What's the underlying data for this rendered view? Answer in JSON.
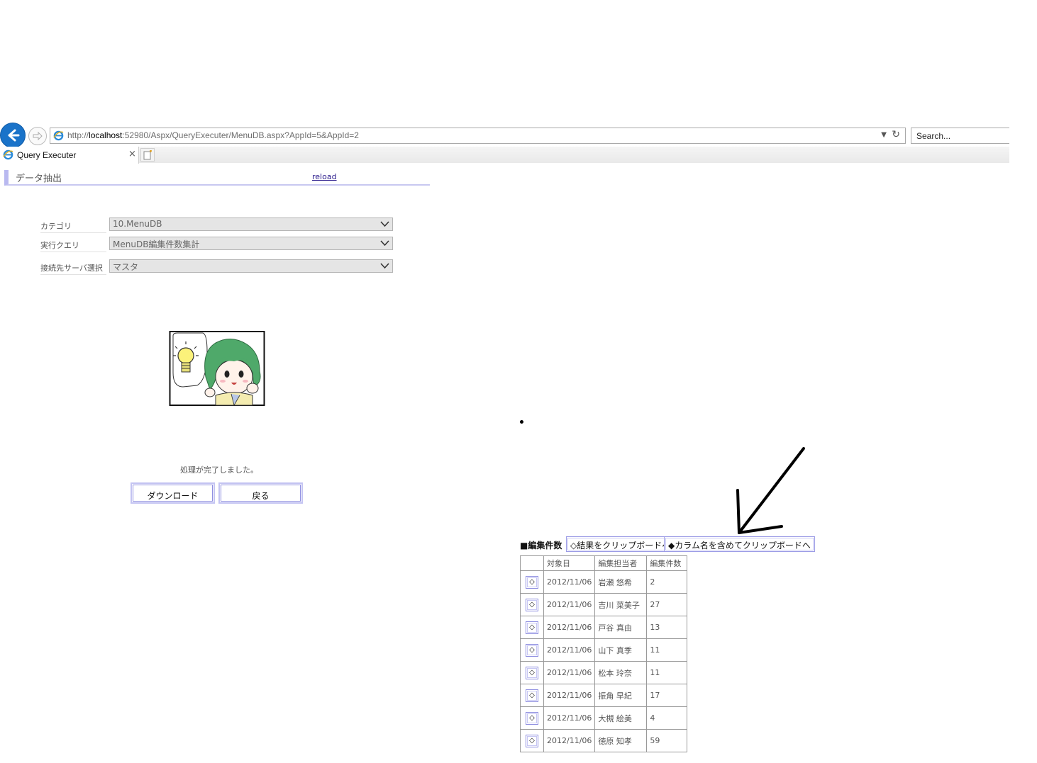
{
  "browser": {
    "url_prefix": "http://",
    "url_host": "localhost",
    "url_rest": ":52980/Aspx/QueryExecuter/MenuDB.aspx?AppId=5&AppId=2",
    "search_placeholder": "Search...",
    "tab_title": "Query Executer",
    "tab_close": "×"
  },
  "header": {
    "title": "データ抽出",
    "reload": "reload"
  },
  "form": {
    "category_label": "カテゴリ",
    "category_value": "10.MenuDB",
    "query_label": "実行クエリ",
    "query_value": "MenuDB編集件数集計",
    "server_label": "接続先サーバ選択",
    "server_value": "マスタ"
  },
  "status": {
    "message": "処理が完了しました。",
    "download_button": "ダウンロード",
    "back_button": "戻る"
  },
  "results": {
    "heading": "■編集件数",
    "copy_results_button": "◇結果をクリップボードへ",
    "copy_with_columns_button": "◆カラム名を含めてクリップボードへ",
    "columns": [
      "",
      "対象日",
      "編集担当者",
      "編集件数"
    ],
    "row_button": "◇",
    "rows": [
      {
        "date": "2012/11/06",
        "editor": "岩瀬 悠希",
        "count": "2"
      },
      {
        "date": "2012/11/06",
        "editor": "吉川 菜美子",
        "count": "27"
      },
      {
        "date": "2012/11/06",
        "editor": "戸谷 真由",
        "count": "13"
      },
      {
        "date": "2012/11/06",
        "editor": "山下 真季",
        "count": "11"
      },
      {
        "date": "2012/11/06",
        "editor": "松本 玲奈",
        "count": "11"
      },
      {
        "date": "2012/11/06",
        "editor": "振角 早紀",
        "count": "17"
      },
      {
        "date": "2012/11/06",
        "editor": "大槻 絵美",
        "count": "4"
      },
      {
        "date": "2012/11/06",
        "editor": "徳原 知孝",
        "count": "59"
      }
    ]
  },
  "icons": {
    "back": "back-arrow-icon",
    "forward": "forward-arrow-icon",
    "ie": "ie-icon",
    "refresh": "refresh-icon",
    "dropdown": "chevron-down-icon",
    "new_tab": "new-tab-icon"
  },
  "colors": {
    "back_button": "#1a73c9",
    "header_accent": "#b9b9f0",
    "button_border": "#8e8ee0",
    "link": "#2a1a8c"
  }
}
